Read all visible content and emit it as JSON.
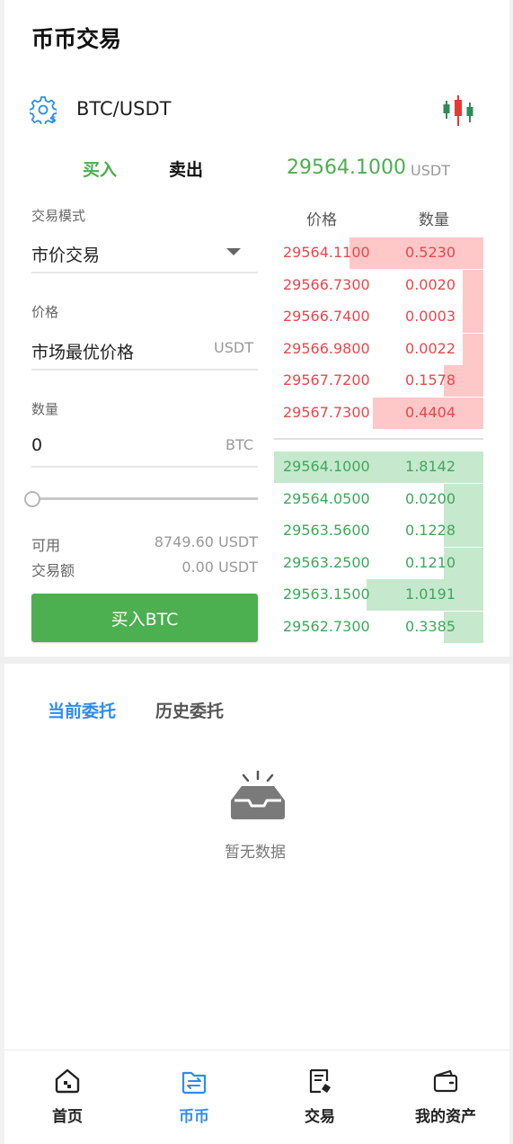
{
  "header": {
    "title": "币币交易"
  },
  "pair": {
    "name": "BTC/USDT",
    "settings_icon": "settings-dollar-icon",
    "chart_icon": "candlestick-chart-icon"
  },
  "trade_tabs": {
    "buy": "买入",
    "sell": "卖出"
  },
  "last_price": {
    "value": "29564.1000",
    "unit": "USDT"
  },
  "form": {
    "mode_label": "交易模式",
    "mode_value": "市价交易",
    "price_label": "价格",
    "price_value": "市场最优价格",
    "price_unit": "USDT",
    "qty_label": "数量",
    "qty_value": "0",
    "qty_unit": "BTC",
    "slider_percent": 0,
    "available_label": "可用",
    "available_value": "8749.60 USDT",
    "amount_label": "交易额",
    "amount_value": "0.00 USDT",
    "submit_label": "买入BTC"
  },
  "orderbook": {
    "price_header": "价格",
    "qty_header": "数量",
    "asks": [
      {
        "price": "29564.1100",
        "qty": "0.5230",
        "depth": 0.64
      },
      {
        "price": "29566.7300",
        "qty": "0.0020",
        "depth": 0.1
      },
      {
        "price": "29566.7400",
        "qty": "0.0003",
        "depth": 0.1
      },
      {
        "price": "29566.9800",
        "qty": "0.0022",
        "depth": 0.1
      },
      {
        "price": "29567.7200",
        "qty": "0.1578",
        "depth": 0.19
      },
      {
        "price": "29567.7300",
        "qty": "0.4404",
        "depth": 0.53
      }
    ],
    "bids": [
      {
        "price": "29564.1000",
        "qty": "1.8142",
        "depth": 1.0
      },
      {
        "price": "29564.0500",
        "qty": "0.0200",
        "depth": 0.19
      },
      {
        "price": "29563.5600",
        "qty": "0.1228",
        "depth": 0.19
      },
      {
        "price": "29563.2500",
        "qty": "0.1210",
        "depth": 0.19
      },
      {
        "price": "29563.1500",
        "qty": "1.0191",
        "depth": 0.56
      },
      {
        "price": "29562.7300",
        "qty": "0.3385",
        "depth": 0.19
      }
    ],
    "ask_color": "#e8474b",
    "bid_color": "#3fa85a"
  },
  "orders": {
    "tab_current": "当前委托",
    "tab_history": "历史委托",
    "empty_icon": "empty-inbox-icon",
    "empty_text": "暂无数据"
  },
  "nav": {
    "items": [
      {
        "label": "首页",
        "icon": "home-icon"
      },
      {
        "label": "币币",
        "icon": "exchange-icon"
      },
      {
        "label": "交易",
        "icon": "trade-document-icon"
      },
      {
        "label": "我的资产",
        "icon": "wallet-icon"
      }
    ],
    "active_color": "#2d8cf0"
  }
}
